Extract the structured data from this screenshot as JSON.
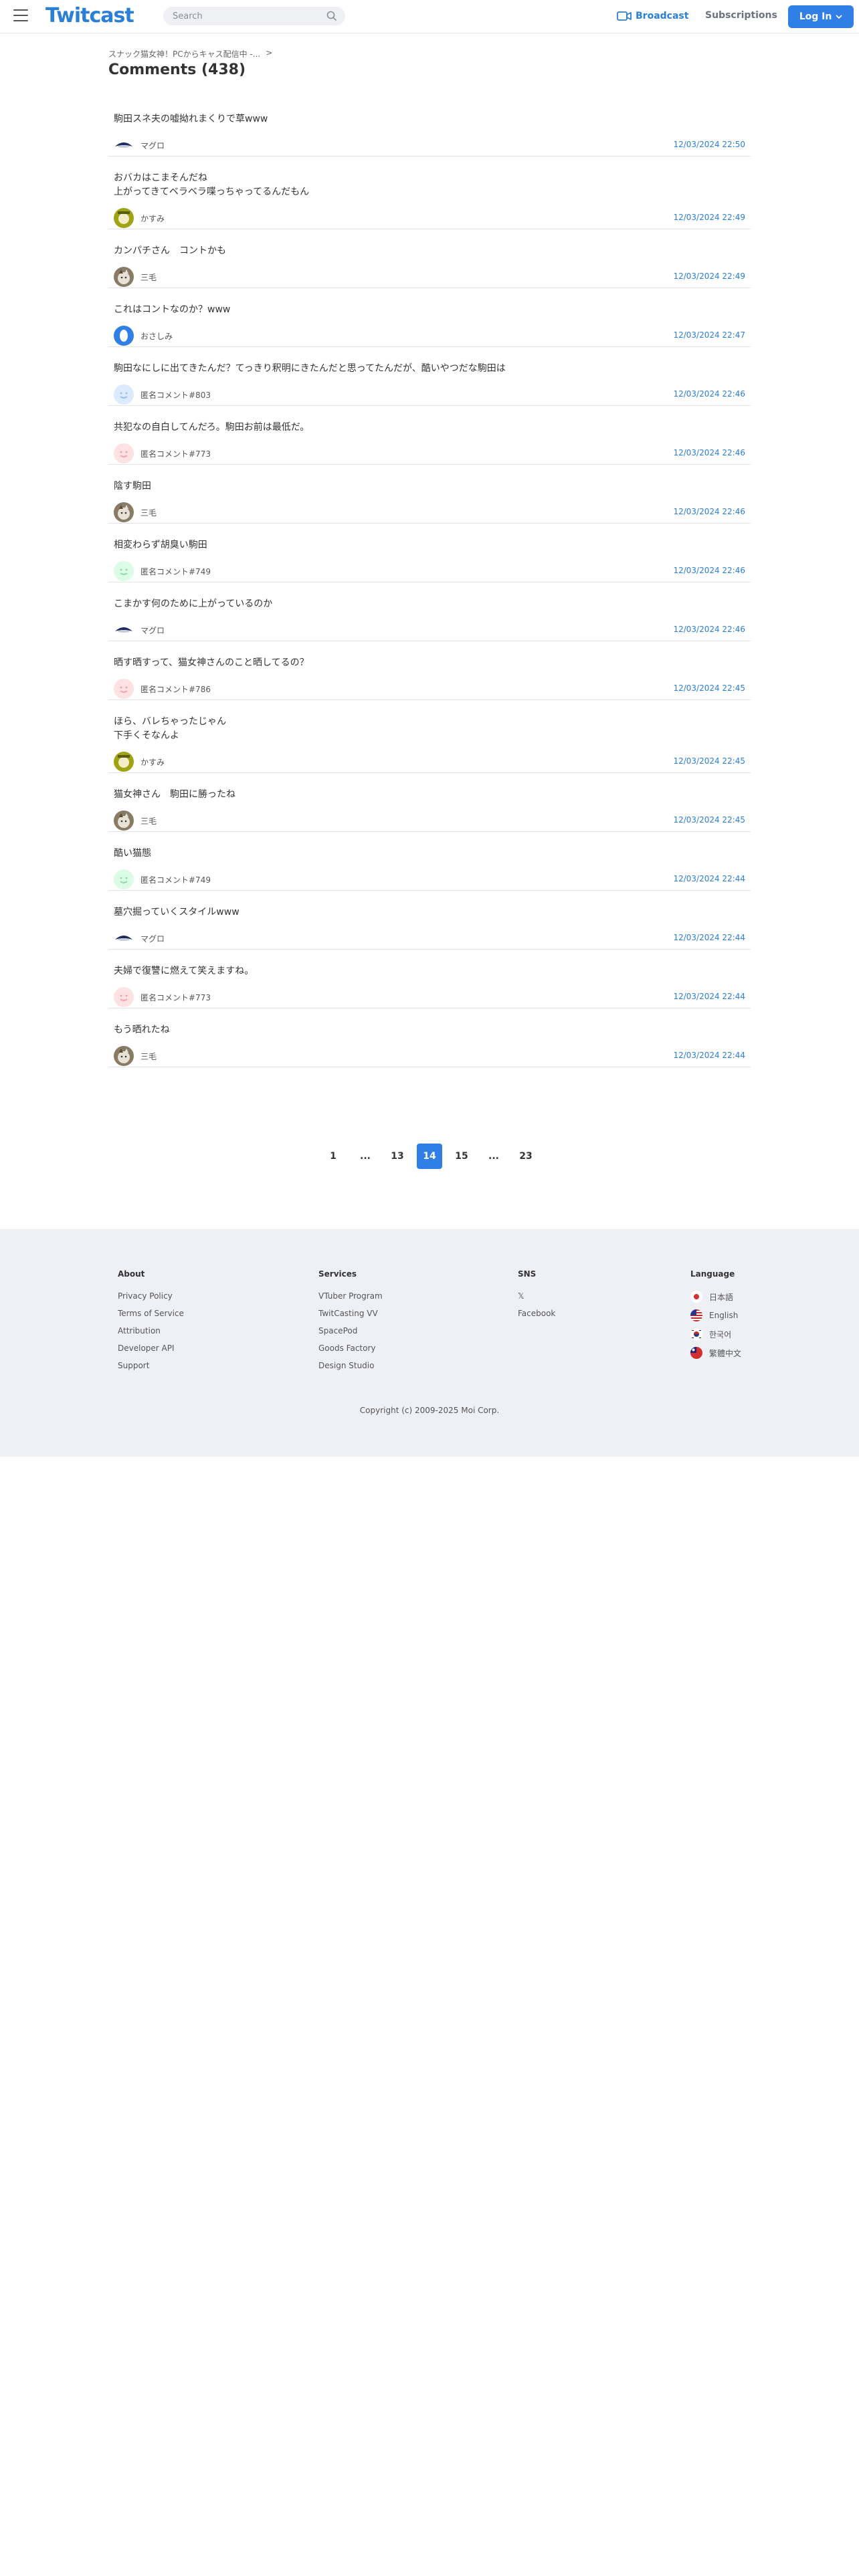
{
  "header": {
    "logo": "Twitcast",
    "search_placeholder": "Search",
    "broadcast_label": "Broadcast",
    "subscriptions_label": "Subscriptions",
    "login_label": "Log In",
    "accent_color": "#2f7fe6"
  },
  "breadcrumb": {
    "channel": "スナック猫女神！PCからキャス配信中 -...",
    "separator": ">"
  },
  "page": {
    "title": "Comments (438)"
  },
  "comments": [
    {
      "text": "駒田スネ夫の嘘拗れまくりで草www",
      "user": "マグロ",
      "time": "12/03/2024 22:50"
    },
    {
      "text": "おバカはこまそんだね\n上がってきてベラベラ喋っちゃってるんだもん",
      "user": "かすみ",
      "time": "12/03/2024 22:49"
    },
    {
      "text": "カンパチさん　コントかも",
      "user": "三毛",
      "time": "12/03/2024 22:49"
    },
    {
      "text": "これはコントなのか？www",
      "user": "おさしみ",
      "time": "12/03/2024 22:47"
    },
    {
      "text": "駒田なにしに出てきたんだ？てっきり釈明にきたんだと思ってたんだが、酷いやつだな駒田は",
      "user": "匿名コメント#803",
      "time": "12/03/2024 22:46"
    },
    {
      "text": "共犯なの自白してんだろ。駒田お前は最低だ。",
      "user": "匿名コメント#773",
      "time": "12/03/2024 22:46"
    },
    {
      "text": "陰す駒田",
      "user": "三毛",
      "time": "12/03/2024 22:46"
    },
    {
      "text": "相変わらず胡臭い駒田",
      "user": "匿名コメント#749",
      "time": "12/03/2024 22:46"
    },
    {
      "text": "こまかす何のために上がっているのか",
      "user": "マグロ",
      "time": "12/03/2024 22:46"
    },
    {
      "text": "晒す晒すって、猫女神さんのこと晒してるの？",
      "user": "匿名コメント#786",
      "time": "12/03/2024 22:45"
    },
    {
      "text": "ほら、バレちゃったじゃん\n下手くそなんよ",
      "user": "かすみ",
      "time": "12/03/2024 22:45"
    },
    {
      "text": "猫女神さん　駒田に勝ったね",
      "user": "三毛",
      "time": "12/03/2024 22:45"
    },
    {
      "text": "酷い猫態",
      "user": "匿名コメント#749",
      "time": "12/03/2024 22:44"
    },
    {
      "text": "墓穴掘っていくスタイルwww",
      "user": "マグロ",
      "time": "12/03/2024 22:44"
    },
    {
      "text": "夫婦で復讐に燃えて笑えますね。",
      "user": "匿名コメント#773",
      "time": "12/03/2024 22:44"
    },
    {
      "text": "もう晒れたね",
      "user": "三毛",
      "time": "12/03/2024 22:44"
    }
  ],
  "pagination": [
    "1",
    "...",
    "13",
    "14",
    "15",
    "...",
    "23"
  ],
  "pagination_active": "14",
  "footer": {
    "about": {
      "title": "About",
      "links": [
        "Privacy Policy",
        "Terms of Service",
        "Attribution",
        "Developer API",
        "Support"
      ]
    },
    "services": {
      "title": "Services",
      "links": [
        "VTuber Program",
        "TwitCasting VV",
        "SpacePod",
        "Goods Factory",
        "Design Studio"
      ]
    },
    "sns": {
      "title": "SNS",
      "links": [
        "𝕏",
        "Facebook"
      ]
    },
    "language": {
      "title": "Language",
      "items": [
        {
          "label": "日本語",
          "flag": "japan-flag-icon"
        },
        {
          "label": "English",
          "flag": "us-flag-icon"
        },
        {
          "label": "한국어",
          "flag": "korea-flag-icon"
        },
        {
          "label": "繁體中文",
          "flag": "taiwan-flag-icon"
        }
      ]
    },
    "copyright": "Copyright (c) 2009-2025 Moi Corp."
  }
}
